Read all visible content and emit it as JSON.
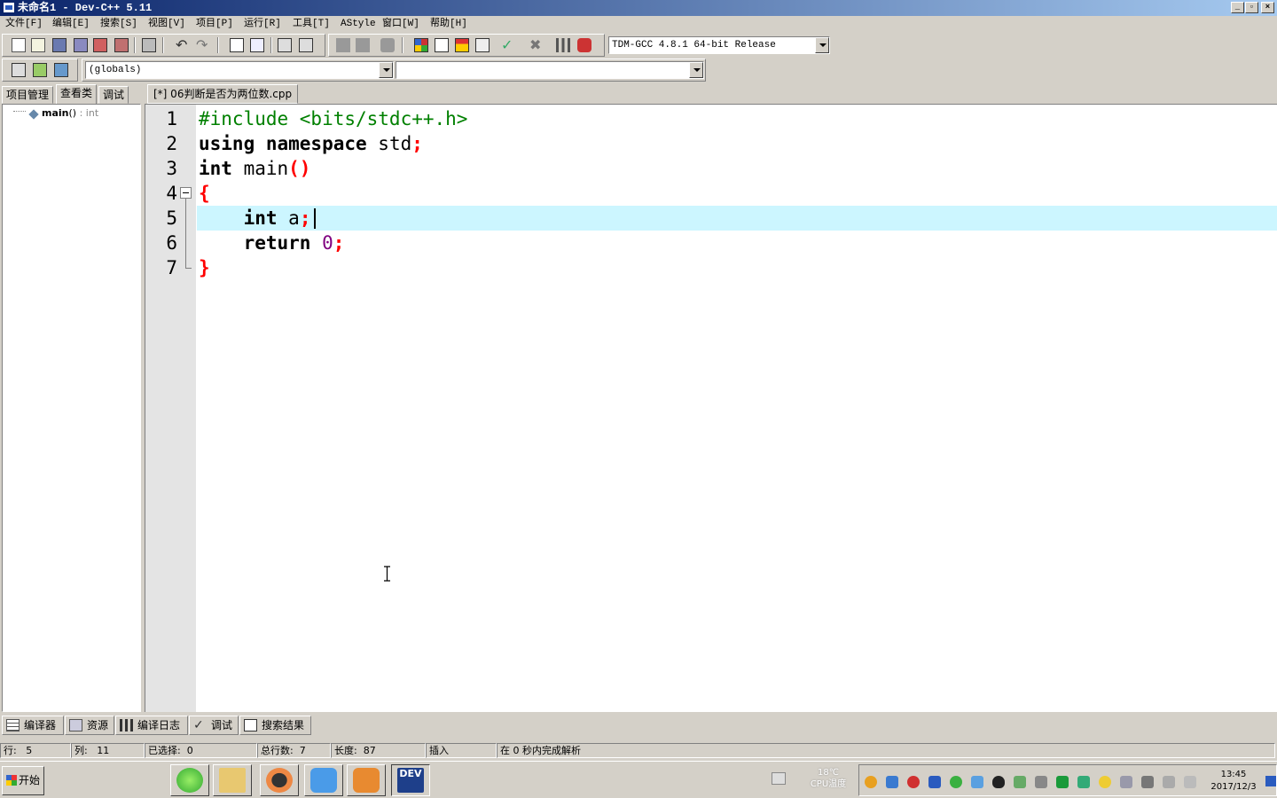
{
  "window": {
    "title": "未命名1 - Dev-C++ 5.11"
  },
  "menu": [
    "文件[F]",
    "编辑[E]",
    "搜索[S]",
    "视图[V]",
    "项目[P]",
    "运行[R]",
    "工具[T]",
    "AStyle",
    "窗口[W]",
    "帮助[H]"
  ],
  "toolbar": {
    "compiler_select": "TDM-GCC 4.8.1 64-bit Release",
    "scope_select": "(globals)",
    "function_select": ""
  },
  "left_panel": {
    "tabs": [
      "项目管理",
      "查看类",
      "调试"
    ],
    "class_tree": [
      {
        "name": "main",
        "paren": "()",
        "type": " : int"
      }
    ]
  },
  "editor": {
    "file_tab": "[*] 06判断是否为两位数.cpp",
    "line_numbers": [
      "1",
      "2",
      "3",
      "4",
      "5",
      "6",
      "7"
    ],
    "lines": [
      {
        "tokens": [
          {
            "t": "#include <bits/stdc++.h>",
            "c": "pp"
          }
        ]
      },
      {
        "tokens": [
          {
            "t": "using namespace",
            "c": "kw"
          },
          {
            "t": " std",
            "c": ""
          },
          {
            "t": ";",
            "c": "sym"
          }
        ]
      },
      {
        "tokens": [
          {
            "t": "int",
            "c": "kw"
          },
          {
            "t": " main",
            "c": ""
          },
          {
            "t": "()",
            "c": "sym"
          }
        ]
      },
      {
        "tokens": [
          {
            "t": "{",
            "c": "sym"
          }
        ]
      },
      {
        "tokens": [
          {
            "t": "    ",
            "c": ""
          },
          {
            "t": "int",
            "c": "kw"
          },
          {
            "t": " a",
            "c": ""
          },
          {
            "t": ";",
            "c": "sym"
          }
        ]
      },
      {
        "tokens": [
          {
            "t": "    ",
            "c": ""
          },
          {
            "t": "return",
            "c": "kw"
          },
          {
            "t": " ",
            "c": ""
          },
          {
            "t": "0",
            "c": "num"
          },
          {
            "t": ";",
            "c": "sym"
          }
        ]
      },
      {
        "tokens": [
          {
            "t": "}",
            "c": "sym"
          }
        ]
      }
    ]
  },
  "bottom_tabs": [
    "编译器",
    "资源",
    "编译日志",
    "调试",
    "搜索结果"
  ],
  "status": {
    "row_label": "行:",
    "row": "5",
    "col_label": "列:",
    "col": "11",
    "sel_label": "已选择:",
    "sel": "0",
    "total_label": "总行数:",
    "total": "7",
    "len_label": "长度:",
    "len": "87",
    "mode": "插入",
    "message": "在 0 秒内完成解析"
  },
  "taskbar": {
    "start_label": "开始",
    "temperature": "18℃",
    "temp_label": "CPU温度",
    "time": "13:45",
    "date": "2017/12/3"
  },
  "colors": {
    "current_line": "#ccf6ff",
    "preprocessor": "#008000",
    "symbol": "#ff0000",
    "number": "#800080",
    "titlebar": "#0a246a"
  }
}
